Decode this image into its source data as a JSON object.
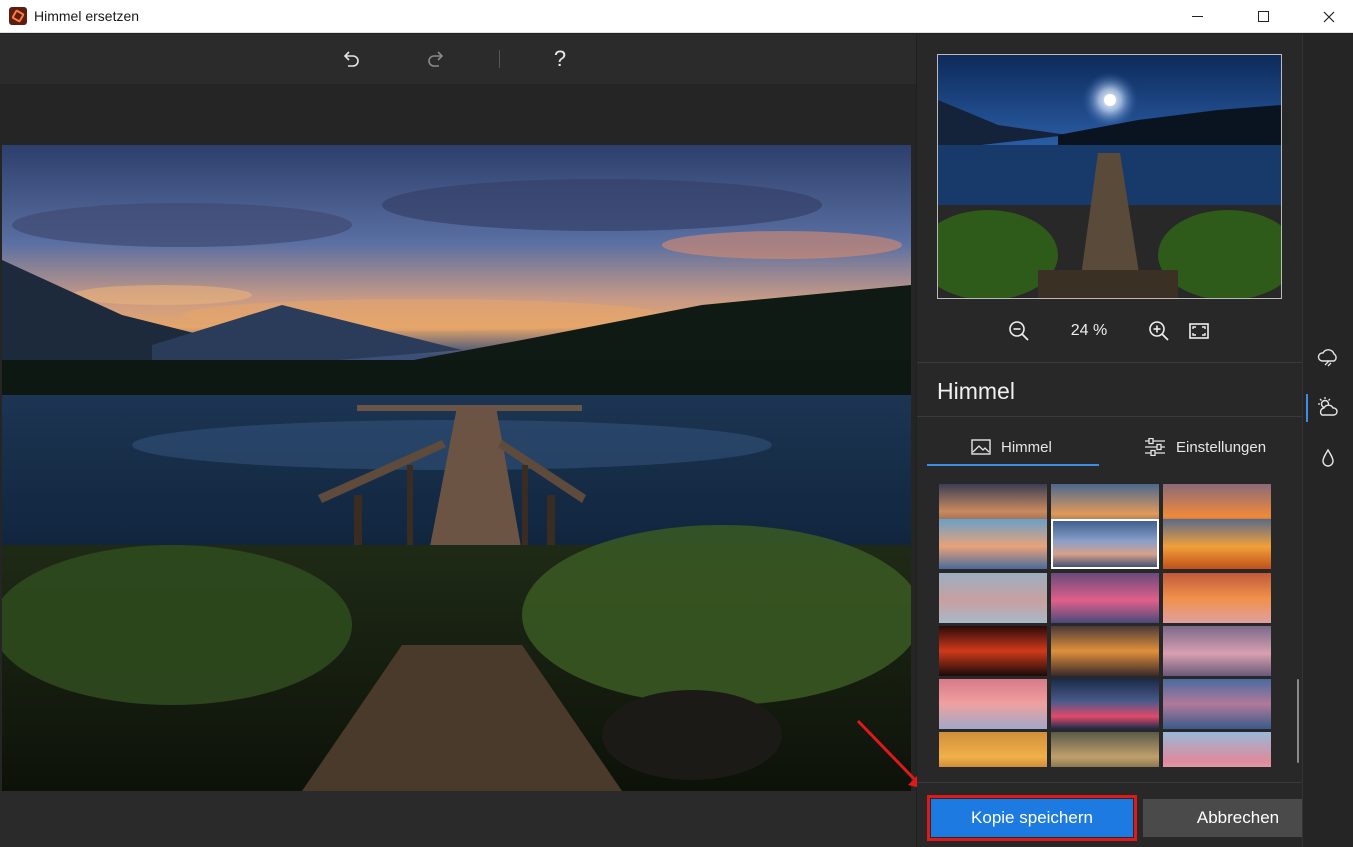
{
  "window": {
    "title": "Himmel ersetzen"
  },
  "toolbar": {
    "undo_icon": "undo-icon",
    "redo_icon": "redo-icon",
    "help_label": "?"
  },
  "preview": {
    "zoom_label": "24 %",
    "zoom_out_icon": "zoom-out-icon",
    "zoom_in_icon": "zoom-in-icon",
    "fit_icon": "fit-screen-icon"
  },
  "panel": {
    "section_title": "Himmel",
    "tabs": [
      {
        "label": "Himmel",
        "icon": "image-icon",
        "active": true
      },
      {
        "label": "Einstellungen",
        "icon": "sliders-icon",
        "active": false
      }
    ],
    "selected_thumbnail": 5
  },
  "actions": {
    "save_label": "Kopie speichern",
    "cancel_label": "Abbrechen"
  },
  "rail": {
    "items": [
      "weather-icon",
      "sky-sun-icon",
      "drop-icon"
    ],
    "active_index": 1
  },
  "colors": {
    "accent": "#1d7ae0",
    "highlight_box": "#e01818",
    "background": "#202020"
  }
}
